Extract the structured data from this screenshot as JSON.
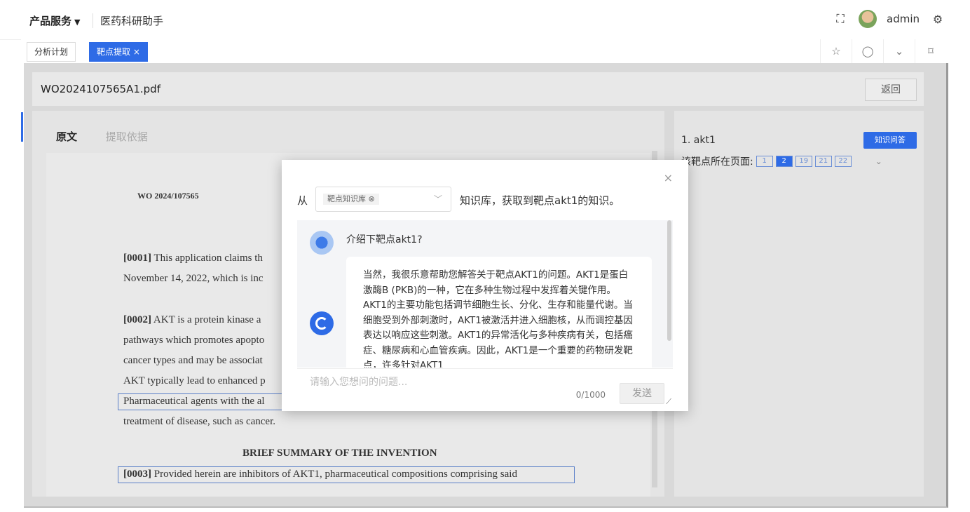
{
  "header": {
    "product_menu": "产品服务",
    "product_caret": "▼",
    "app_name": "医药科研助手",
    "user_name": "admin"
  },
  "tabs": [
    {
      "label": "分析计划"
    },
    {
      "label": "靶点提取 ×"
    }
  ],
  "file": {
    "name": "WO2024107565A1.pdf",
    "back_label": "返回"
  },
  "left_panel": {
    "tab_original": "原文",
    "tab_basis": "提取依据"
  },
  "document": {
    "header": "WO 2024/107565",
    "p1_a": "[0001]",
    "p1_b": " This application claims th",
    "p1_c": "November 14, 2022, which is inc",
    "p2_a": "[0002]",
    "p2_b": " AKT is a protein kinase a",
    "p2_c": "pathways which promotes apopto",
    "p2_d": "cancer types and may be associat",
    "p2_e": "AKT typically lead to enhanced p",
    "p2_f": "Pharmaceutical agents with the al",
    "p2_g": "treatment of disease, such as cancer.",
    "section_heading": "BRIEF SUMMARY OF THE INVENTION",
    "p3_a": "[0003]",
    "p3_b": " Provided herein are inhibitors of AKT1, pharmaceutical compositions comprising said"
  },
  "right_panel": {
    "target_item": "1. akt1",
    "qa_button": "知识问答",
    "pages_label": "该靶点所在页面:",
    "pages": [
      "1",
      "2",
      "19",
      "21",
      "22"
    ],
    "active_page": "2",
    "chevron": "⌄"
  },
  "modal": {
    "close": "×",
    "from_label": "从",
    "kb_value": "靶点知识库",
    "kb_clear": "⊗",
    "kb_caret": "﹀",
    "from_tail": "知识库，获取到靶点akt1的知识。",
    "question": "介绍下靶点akt1?",
    "answer": "当然，我很乐意帮助您解答关于靶点AKT1的问题。AKT1是蛋白激酶B (PKB)的一种，它在多种生物过程中发挥着关键作用。AKT1的主要功能包括调节细胞生长、分化、生存和能量代谢。当细胞受到外部刺激时，AKT1被激活并进入细胞核，从而调控基因表达以响应这些刺激。AKT1的异常活化与多种疾病有关，包括癌症、糖尿病和心血管疾病。因此，AKT1是一个重要的药物研发靶点，许多针对AKT1",
    "input_placeholder": "请输入您想问的问题...",
    "char_count": "0/1000",
    "send_label": "发送"
  },
  "icons": {
    "fullscreen": "⛶",
    "settings": "⚙",
    "pin": "☆",
    "refresh": "◯",
    "dropdown": "⌄",
    "maximize": "⌑",
    "resize": "⟋"
  },
  "colors": {
    "accent": "#2e6be6"
  }
}
